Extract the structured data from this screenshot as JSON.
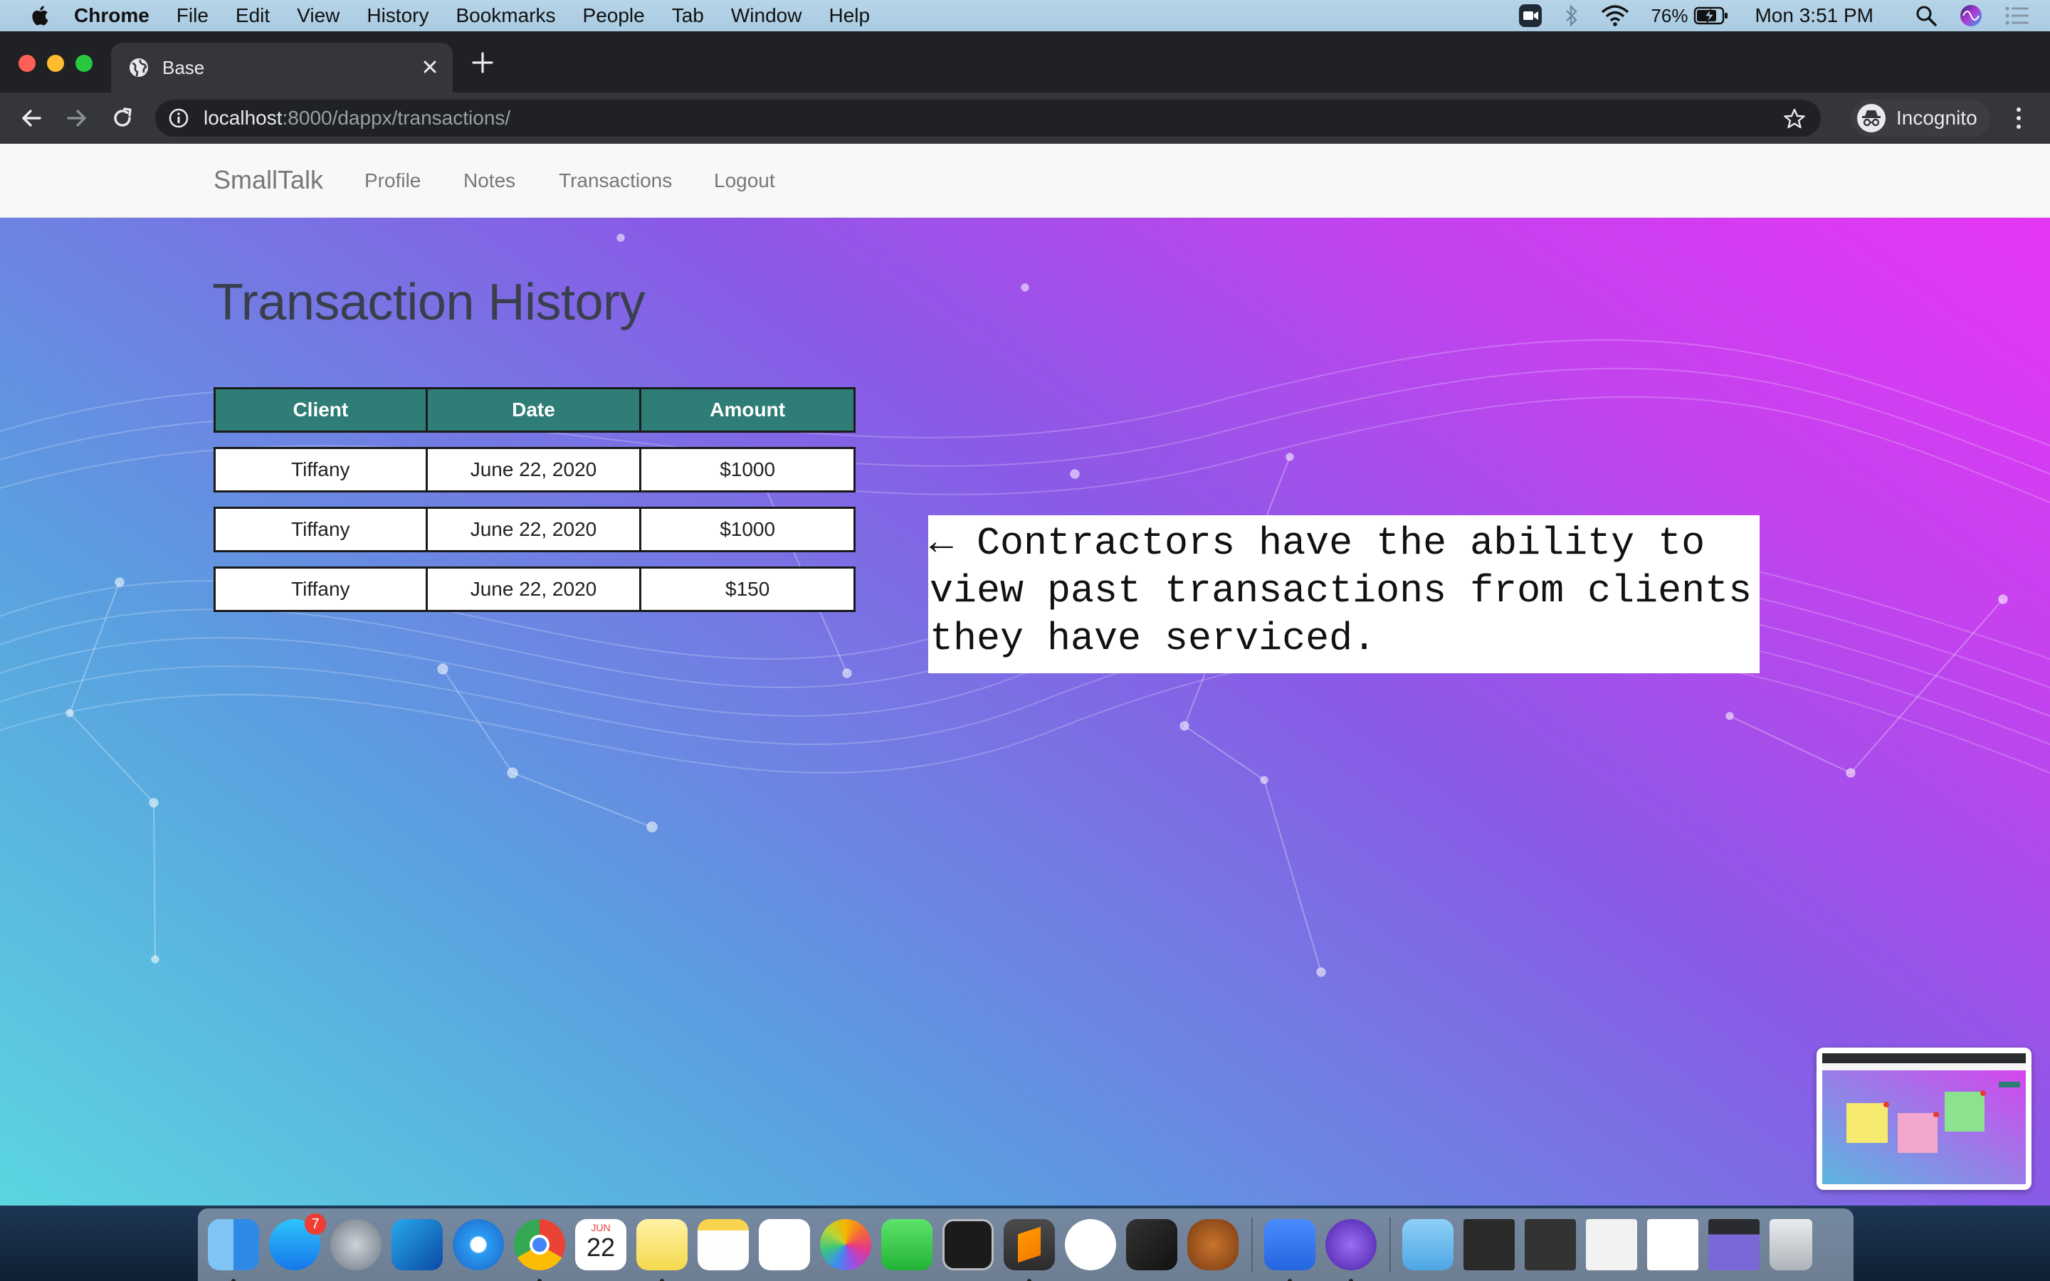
{
  "menubar": {
    "app": "Chrome",
    "items": [
      "File",
      "Edit",
      "View",
      "History",
      "Bookmarks",
      "People",
      "Tab",
      "Window",
      "Help"
    ],
    "battery": "76%",
    "clock": "Mon 3:51 PM"
  },
  "browser": {
    "tab_title": "Base",
    "url_host": "localhost",
    "url_path": ":8000/dappx/transactions/",
    "profile_label": "Incognito"
  },
  "site": {
    "brand": "SmallTalk",
    "nav": [
      "Profile",
      "Notes",
      "Transactions",
      "Logout"
    ]
  },
  "page": {
    "title": "Transaction History",
    "table": {
      "headers": [
        "Client",
        "Date",
        "Amount"
      ],
      "rows": [
        [
          "Tiffany",
          "June 22, 2020",
          "$1000"
        ],
        [
          "Tiffany",
          "June 22, 2020",
          "$1000"
        ],
        [
          "Tiffany",
          "June 22, 2020",
          "$150"
        ]
      ]
    },
    "callout": "← Contractors have the ability to\nview past transactions from clients\nthey have serviced."
  },
  "dock": {
    "apps": [
      "Finder",
      "App Store",
      "Launchpad",
      "Outlook",
      "Safari",
      "Chrome",
      "Calendar",
      "Stickies",
      "Notes",
      "Reminders",
      "Photos",
      "FaceTime",
      "Terminal",
      "Sublime Text",
      "Slack",
      "Final Cut Pro",
      "Transmit",
      "Zoom",
      "iMovie"
    ],
    "app_store_badge": "7",
    "calendar_month": "JUN",
    "calendar_day": "22"
  },
  "colors": {
    "table_header": "#2f7d77",
    "gradient_start": "#5bd6df",
    "gradient_end": "#e636f5"
  }
}
